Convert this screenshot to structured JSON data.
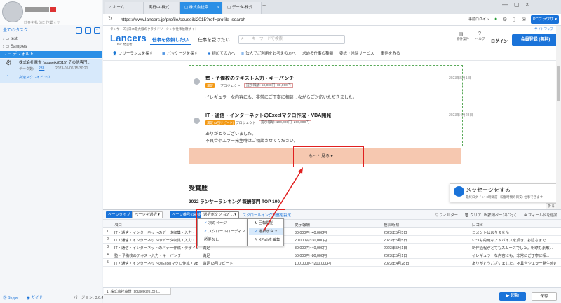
{
  "sidebar": {
    "user_email": "料金を払うに 作業 × ▽",
    "tasks_header": "全てのタスク",
    "folders": [
      {
        "label": "test"
      },
      {
        "label": "Samples"
      },
      {
        "label": "デフォルト"
      }
    ],
    "task": {
      "title": "株式会社章世 (souseiki2015) その他専門...",
      "count_label": "データ数:",
      "count": "233",
      "date": "2023-05-06 15:30:21",
      "crawl": "高速スクレイピング"
    },
    "footer": {
      "skype": "Skype",
      "guide": "ガイド",
      "version": "バージョン: 3.6.4"
    }
  },
  "browser": {
    "tabs": [
      {
        "label": "ホーム..."
      },
      {
        "label": "実行中-株式..."
      },
      {
        "label": "株式会社章..."
      },
      {
        "label": "データ-株式..."
      }
    ],
    "url": "https://www.lancers.jp/profile/souseiki2015?ref=profile_search",
    "premier_label": "事前ログイン",
    "pc_browser": "PCブラウザ ▾"
  },
  "site": {
    "tagline": "ランサーズ | 日本最大級のクラウドソーシング仕事依頼サイト",
    "sitemap": "サイトマップ",
    "logo": "Lancers",
    "logo_sub": "For 発注者",
    "nav_hire": "仕事を依頼したい",
    "nav_receive": "仕事を受けたい",
    "search_placeholder": "キーワードで検索",
    "hdr_bukken": "物件案件",
    "hdr_help": "ヘルプ",
    "login": "ログイン",
    "signup": "会員登録 (無料)",
    "subnav": [
      "フリーランスを探す",
      "パッケージを探す",
      "初めての方へ",
      "法人でご利用をお考えの方へ",
      "求める仕事の種類",
      "委託・常駐サービス",
      "事例をみる"
    ],
    "entries": [
      {
        "title": "塾・予備校のテキスト入力・キーパンチ",
        "date": "2023年5月1日",
        "tag": "満足",
        "type": "プロジェクト",
        "budget": "提示報酬: 50,000円~80,000円",
        "comment": "イレギュラーな内容にも、非常にご丁寧に相談しながらご対応いただきました。"
      },
      {
        "title": "IT・通信・インターネットのExcelマクロ作成・VBA開発",
        "date": "2023年4月28日",
        "tag": "満足 (3回リピート)",
        "type": "プロジェクト",
        "budget": "提示報酬: 100,000円~200,000円",
        "comment": "ありがとうございました。",
        "comment2": "不具合やエラー発生時はご相談させてください。"
      }
    ],
    "more": "もっと見る ▾",
    "award": "受賞歴",
    "rank": "2022 ランサーランキング 報酬部門 TOP 100",
    "msg_title": "メッセージをする",
    "msg_sub": "最終ログイン: 0時間前 | 稼働時間の目安: 仕事できます",
    "fold": "折る"
  },
  "panel": {
    "page_type_btn": "ページタイプ",
    "page_select": "ページを選択 ▾",
    "page_num_btn": "ページ番号の設定",
    "select_btn": "選択ボタン など... ▾",
    "scroll_setting": "スクロールイング調整を設定",
    "filter": "フィルター",
    "clear": "クリア",
    "detail": "詳細ページに行く",
    "add_field": "フィールドを追加",
    "columns": [
      "項目",
      "",
      "提示報酬",
      "投稿時期",
      "口コミ"
    ],
    "rows": [
      {
        "n": "1",
        "c2": "IT・通信・インターネットのデータ収集・入力・リ...",
        "c3": "満足",
        "c4": "30,000円~40,000円",
        "c5": "2023年5月5日",
        "c6": "コメントはありません"
      },
      {
        "n": "2",
        "c2": "IT・通信・インターネットのデータ収集・入力・リ...",
        "c3": "満足",
        "c4": "20,000円~30,000円",
        "c5": "2023年5月5日",
        "c6": "いつも的確なアドバイスを頂き、お陰さまで..."
      },
      {
        "n": "3",
        "c2": "IT・通信・インターネットのバナー作成・デザイン...",
        "c3": "満足",
        "c4": "30,000円~40,000円",
        "c5": "2023年5月1日",
        "c6": "制作過程がとてもスムーズでした。明瞭も素敵..."
      },
      {
        "n": "4",
        "c2": "塾・予備校のテキスト入力・キーパンチ",
        "c3": "満足",
        "c4": "50,000円~80,000円",
        "c5": "2023年5月1日",
        "c6": "イレギュラーな内容にも、非常にご丁寧に相..."
      },
      {
        "n": "5",
        "c2": "IT・通信・インターネットのExcelマクロ作成・VBA...",
        "c3": "満足 (3回リピート)",
        "c4": "100,000円~200,000円",
        "c5": "2023年4月28日",
        "c6": "ありがとうございました。不具合やエラー発生時は..."
      }
    ],
    "dd1": [
      {
        "label": "次のページ",
        "checked": "✓"
      },
      {
        "label": "スクロールローディング",
        "checked": "✓"
      },
      {
        "label": "必要なし",
        "checked": ""
      }
    ],
    "dd2": [
      {
        "label": "回転開始"
      },
      {
        "label": "選択ボタン",
        "checked": "✓"
      },
      {
        "label": "XPathを編集"
      }
    ]
  },
  "bottom": {
    "task_tab": "1. 株式会社章世 (souseiki2015) |...",
    "start": "▶ 起動",
    "save": "保存"
  }
}
